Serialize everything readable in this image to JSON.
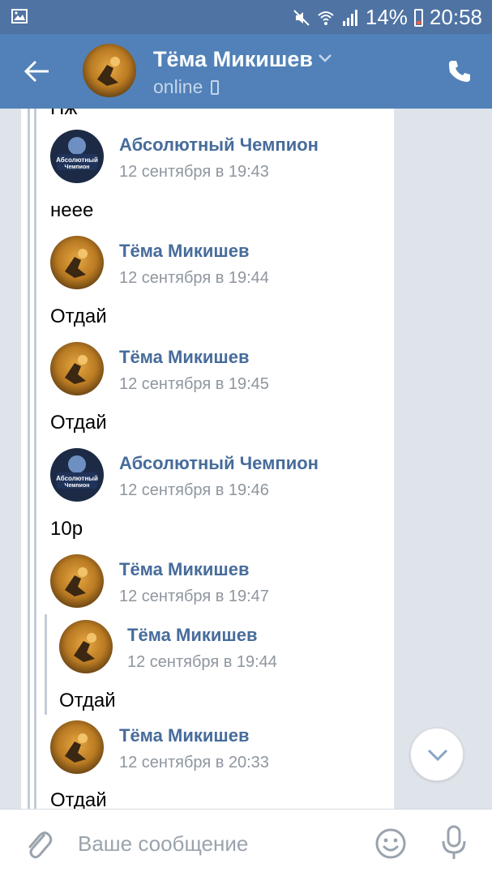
{
  "status_bar": {
    "battery_percent": "14%",
    "time": "20:58",
    "icons": [
      "image-icon",
      "mute-icon",
      "wifi-icon",
      "signal-icon",
      "battery-icon"
    ]
  },
  "header": {
    "contact_name": "Тёма Микишев",
    "status": "online",
    "icons": [
      "back-arrow-icon",
      "chevron-down-icon",
      "mobile-icon",
      "phone-icon"
    ]
  },
  "conversation": {
    "partial_top_text": "Нж",
    "messages": [
      {
        "sender": "Абсолютный Чемпион",
        "date": "12 сентября в 19:43",
        "text": "неее"
      },
      {
        "sender": "Тёма Микишев",
        "date": "12 сентября в 19:44",
        "text": "Отдай"
      },
      {
        "sender": "Тёма Микишев",
        "date": "12 сентября в 19:45",
        "text": "Отдай"
      },
      {
        "sender": "Абсолютный Чемпион",
        "date": "12 сентября в 19:46",
        "text": "10р"
      },
      {
        "sender": "Тёма Микишев",
        "date": "12 сентября в 19:47",
        "text": ""
      },
      {
        "sender": "Тёма Микишев",
        "date": "12 сентября в 20:33",
        "text": "Отдай"
      }
    ],
    "nested_quote": {
      "sender": "Тёма Микишев",
      "date": "12 сентября в 19:44",
      "text": "Отдай"
    },
    "champion_logo_text": [
      "Абсолютный",
      "Чемпион"
    ]
  },
  "compose": {
    "placeholder": "Ваше сообщение",
    "value": "",
    "icons": [
      "paperclip-icon",
      "emoji-icon",
      "microphone-icon"
    ]
  },
  "colors": {
    "status_bar": "#4f73a3",
    "header": "#5181b8",
    "sender_name": "#476c9b",
    "date": "#8e969f",
    "background": "#dfe4ea",
    "quote_line": "#c3ccd8"
  }
}
